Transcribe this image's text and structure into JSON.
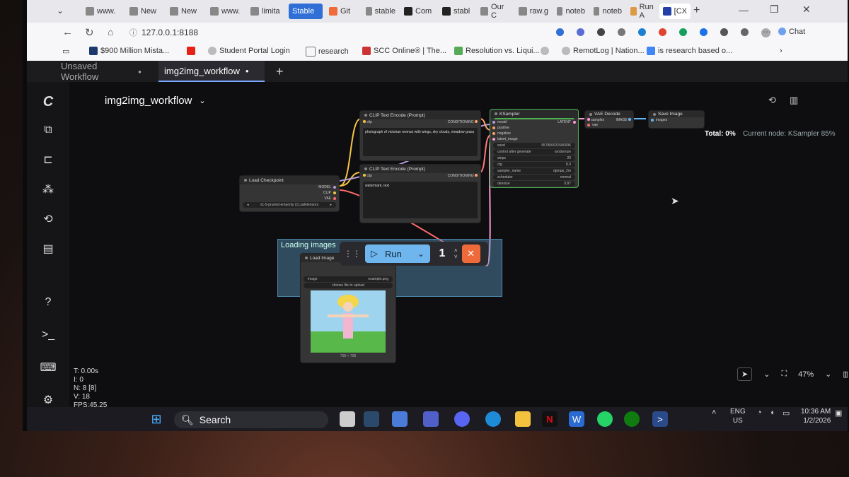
{
  "browser": {
    "tabs": [
      "www.",
      "New",
      "New",
      "www.",
      "limita",
      "Stable",
      "Git",
      "stable",
      "Com",
      "stabl",
      "Our C",
      "raw.g",
      "noteb",
      "noteb",
      "Run A",
      "[CX"
    ],
    "url": "127.0.0.1:8188",
    "bookmarks": [
      "$900 Million Mista...",
      "Student Portal Login",
      "research",
      "SCC Online® | The...",
      "Resolution vs. Liqui...",
      "RemotLog | Nation...",
      "is research based o..."
    ],
    "chat_label": "Chat"
  },
  "comfy": {
    "workflow_tabs": [
      "Unsaved Workflow",
      "img2img_workflow"
    ],
    "workflow_title": "img2img_workflow",
    "total_label": "Total: 0%",
    "current_node": "Current node: KSampler 85%",
    "zoom": "47%",
    "stats": [
      "T: 0.00s",
      "I: 0",
      "N: 8 [8]",
      "V: 18",
      "FPS:45.25"
    ],
    "run_label": "Run",
    "run_count": "1",
    "group_title": "Loading images",
    "nodes": {
      "load_checkpoint": {
        "title": "Load Checkpoint",
        "outputs": [
          "MODEL",
          "CLIP",
          "VAE"
        ],
        "ckpt": "v1-5-pruned-emaonly (1).safetensors"
      },
      "clip1": {
        "title": "CLIP Text Encode (Prompt)",
        "input": "clip",
        "output": "CONDITIONING",
        "text": "photograph of victorian woman with wings, sky clouds, meadow grass"
      },
      "clip2": {
        "title": "CLIP Text Encode (Prompt)",
        "input": "clip",
        "output": "CONDITIONING",
        "text": "watermark, text"
      },
      "ksampler": {
        "title": "KSampler",
        "inputs": [
          "model",
          "positive",
          "negative",
          "latent_image"
        ],
        "output": "LATENT",
        "widgets": [
          [
            "seed",
            "957806631580096"
          ],
          [
            "control after generate",
            "randomize"
          ],
          [
            "steps",
            "20"
          ],
          [
            "cfg",
            "8.0"
          ],
          [
            "sampler_name",
            "dpmpp_2m"
          ],
          [
            "scheduler",
            "normal"
          ],
          [
            "denoise",
            "0.87"
          ]
        ]
      },
      "vae_decode": {
        "title": "VAE Decode",
        "inputs": [
          "samples",
          "vae"
        ],
        "output": "IMAGE"
      },
      "save_image": {
        "title": "Save Image",
        "input": "images"
      },
      "load_image": {
        "title": "Load Image",
        "image_label": "image",
        "image_value": "example.png",
        "upload_label": "choose file to upload",
        "size": "768 × 768"
      }
    }
  },
  "taskbar": {
    "search": "Search",
    "lang": "ENG",
    "region": "US",
    "time": "10:36 AM",
    "date": "1/2/2026"
  },
  "colors": {
    "accent": "#7aa7ff",
    "run_bg": "#6fb6ee",
    "cancel": "#ef6a3a",
    "clip_wire": "#f5c542",
    "model_wire": "#b39ddb",
    "vae_wire": "#ff6b6b",
    "cond_wire": "#ffa06b"
  }
}
